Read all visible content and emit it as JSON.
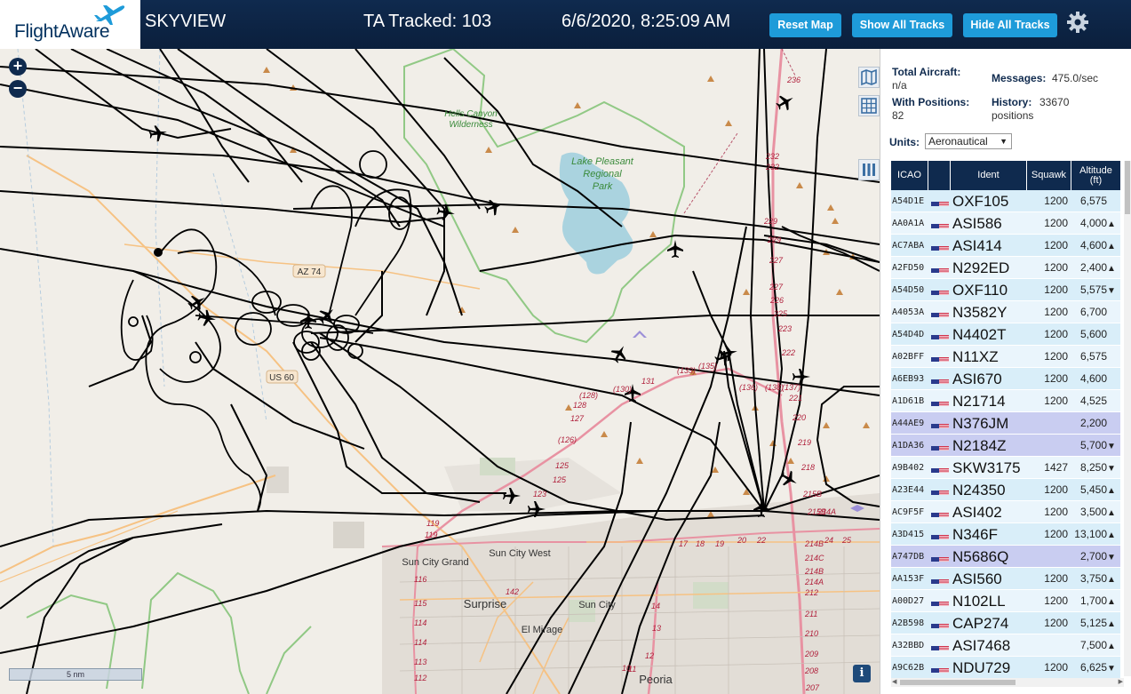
{
  "header": {
    "logo_text": "FlightAware",
    "app_title": "SKYVIEW",
    "ta_tracked": "TA Tracked: 103",
    "datetime": "6/6/2020, 8:25:09 AM",
    "reset_map_label": "Reset Map",
    "show_all_label": "Show All Tracks",
    "hide_all_label": "Hide All Tracks",
    "settings_icon": "gear-icon"
  },
  "map": {
    "zoom_in_label": "+",
    "zoom_out_label": "−",
    "scale_label": "5 nm",
    "info_label": "i",
    "place_labels": [
      "Hells Canyon",
      "Wilderness",
      "Lake Pleasant",
      "Regional",
      "Park",
      "Sun City Grand",
      "Sun City West",
      "Surprise",
      "Sun City",
      "El Mirage",
      "Peoria"
    ],
    "road_labels": [
      "AZ 74",
      "US 60"
    ],
    "waypoint_labels": [
      "236",
      "232",
      "232",
      "229",
      "229",
      "227",
      "227",
      "226",
      "225",
      "223",
      "222",
      "221",
      "220",
      "219",
      "218",
      "215B",
      "215B",
      "214A",
      "214B",
      "214C",
      "214B",
      "214A",
      "212",
      "211",
      "210",
      "209",
      "208",
      "207",
      "131",
      "(130)",
      "(128)",
      "128",
      "127",
      "(126)",
      "125",
      "125",
      "123",
      "(133)",
      "(135)",
      "(136)",
      "(138)",
      "(137)",
      "119",
      "119",
      "116",
      "115",
      "114",
      "114",
      "113",
      "112",
      "142",
      "17",
      "18",
      "19",
      "20",
      "22",
      "24",
      "25",
      "14",
      "13",
      "12",
      "11",
      "10"
    ],
    "colors": {
      "land": "#f1eee8",
      "water": "#aad3df",
      "park_border": "#86c47a",
      "highway": "#e892a2",
      "major_road": "#f6c283",
      "track": "#000000"
    }
  },
  "panel": {
    "total_aircraft_label": "Total Aircraft:",
    "total_aircraft_value": "n/a",
    "with_positions_label": "With Positions:",
    "with_positions_value": "82",
    "messages_label": "Messages:",
    "messages_value": "475.0/sec",
    "history_label": "History:",
    "history_value": "33670",
    "history_unit": "positions",
    "units_label": "Units:",
    "units_value": "Aeronautical"
  },
  "table": {
    "headers": {
      "icao": "ICAO",
      "ident": "Ident",
      "squawk": "Squawk",
      "altitude": "Altitude (ft)"
    },
    "rows": [
      {
        "icao": "A54D1E",
        "ident": "OXF105",
        "squawk": "1200",
        "altitude": "6,575",
        "trend": "",
        "state": "odd"
      },
      {
        "icao": "AA0A1A",
        "ident": "ASI586",
        "squawk": "1200",
        "altitude": "4,000",
        "trend": "▲",
        "state": "even"
      },
      {
        "icao": "AC7ABA",
        "ident": "ASI414",
        "squawk": "1200",
        "altitude": "4,600",
        "trend": "▲",
        "state": "odd"
      },
      {
        "icao": "A2FD50",
        "ident": "N292ED",
        "squawk": "1200",
        "altitude": "2,400",
        "trend": "▲",
        "state": "even"
      },
      {
        "icao": "A54D50",
        "ident": "OXF110",
        "squawk": "1200",
        "altitude": "5,575",
        "trend": "▼",
        "state": "odd"
      },
      {
        "icao": "A4053A",
        "ident": "N3582Y",
        "squawk": "1200",
        "altitude": "6,700",
        "trend": "",
        "state": "even"
      },
      {
        "icao": "A54D4D",
        "ident": "N4402T",
        "squawk": "1200",
        "altitude": "5,600",
        "trend": "",
        "state": "odd"
      },
      {
        "icao": "A02BFF",
        "ident": "N11XZ",
        "squawk": "1200",
        "altitude": "6,575",
        "trend": "",
        "state": "even"
      },
      {
        "icao": "A6EB93",
        "ident": "ASI670",
        "squawk": "1200",
        "altitude": "4,600",
        "trend": "",
        "state": "odd"
      },
      {
        "icao": "A1D61B",
        "ident": "N21714",
        "squawk": "1200",
        "altitude": "4,525",
        "trend": "",
        "state": "even"
      },
      {
        "icao": "A44AE9",
        "ident": "N376JM",
        "squawk": "",
        "altitude": "2,200",
        "trend": "",
        "state": "selected"
      },
      {
        "icao": "A1DA36",
        "ident": "N2184Z",
        "squawk": "",
        "altitude": "5,700",
        "trend": "▼",
        "state": "selected"
      },
      {
        "icao": "A9B402",
        "ident": "SKW3175",
        "squawk": "1427",
        "altitude": "8,250",
        "trend": "▼",
        "state": "even"
      },
      {
        "icao": "A23E44",
        "ident": "N24350",
        "squawk": "1200",
        "altitude": "5,450",
        "trend": "▲",
        "state": "odd"
      },
      {
        "icao": "AC9F5F",
        "ident": "ASI402",
        "squawk": "1200",
        "altitude": "3,500",
        "trend": "▲",
        "state": "even"
      },
      {
        "icao": "A3D415",
        "ident": "N346F",
        "squawk": "1200",
        "altitude": "13,100",
        "trend": "▲",
        "state": "odd"
      },
      {
        "icao": "A747DB",
        "ident": "N5686Q",
        "squawk": "",
        "altitude": "2,700",
        "trend": "▼",
        "state": "selected"
      },
      {
        "icao": "AA153F",
        "ident": "ASI560",
        "squawk": "1200",
        "altitude": "3,750",
        "trend": "▲",
        "state": "odd"
      },
      {
        "icao": "A00D27",
        "ident": "N102LL",
        "squawk": "1200",
        "altitude": "1,700",
        "trend": "▲",
        "state": "even"
      },
      {
        "icao": "A2B598",
        "ident": "CAP274",
        "squawk": "1200",
        "altitude": "5,125",
        "trend": "▲",
        "state": "odd"
      },
      {
        "icao": "A32BBD",
        "ident": "ASI7468",
        "squawk": "",
        "altitude": "7,500",
        "trend": "▲",
        "state": "even"
      },
      {
        "icao": "A9C62B",
        "ident": "NDU729",
        "squawk": "1200",
        "altitude": "6,625",
        "trend": "▼",
        "state": "odd"
      }
    ]
  }
}
